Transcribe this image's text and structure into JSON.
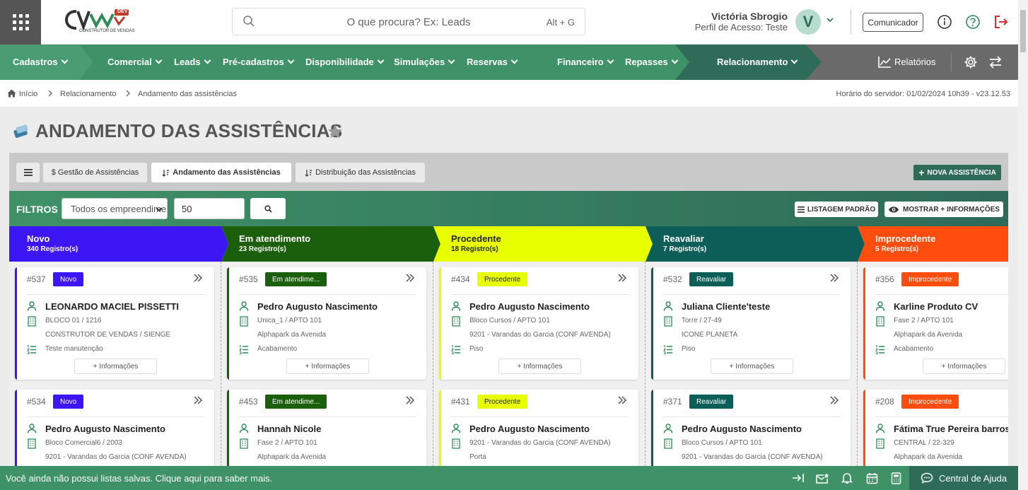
{
  "topbar": {
    "logo_text": "CV",
    "logo_badge": "DEV",
    "logo_sub": "CONSTRUTOR DE VENDAS",
    "search_placeholder": "O que procura? Ex: Leads",
    "search_shortcut": "Alt + G",
    "user_name": "Victória Sbrogio",
    "user_profile": "Perfil de Acesso: Teste",
    "avatar_letter": "V",
    "communicator_label": "Comunicador"
  },
  "nav": {
    "items": [
      "Cadastros",
      "Comercial",
      "Leads",
      "Pré-cadastros",
      "Disponibilidade",
      "Simulações",
      "Reservas",
      "Financeiro",
      "Repasses",
      "Relacionamento"
    ],
    "reports_label": "Relatórios"
  },
  "breadcrumb": {
    "items": [
      "Início",
      "Relacionamento",
      "Andamento das assistências"
    ],
    "server_time": "Horário do servidor: 01/02/2024 10h39 - v23.12.53"
  },
  "page": {
    "title": "ANDAMENTO DAS ASSISTÊNCIAS"
  },
  "tabs": {
    "items": [
      "$ Gestão de Assistências",
      "Andamento das Assistências",
      "Distribuição das Assistências"
    ],
    "new_button": "NOVA ASSISTÊNCIA"
  },
  "filters": {
    "label": "FILTROS",
    "select_value": "Todos os empreendimentos",
    "limit_value": "50",
    "default_list_button": "LISTAGEM PADRÃO",
    "show_more_button": "MOSTRAR + INFORMAÇÕES"
  },
  "colors": {
    "green": "#3f9167",
    "dark_green": "#2e6b59",
    "novo": "#3d16f5",
    "em_atendimento": "#1b5e0c",
    "procedente": "#e8ff00",
    "reavaliar": "#0d5e58",
    "improcedente": "#ff4d0d"
  },
  "more_info_label": "+ Informações",
  "columns": [
    {
      "name": "Novo",
      "count": "340 Registro(s)",
      "cards": [
        {
          "id": "#537",
          "badge": "Novo",
          "name": "LEONARDO MACIEL PISSETTI",
          "unit": "BLOCO 01 / 1216",
          "project": "CONSTRUTOR DE VENDAS / SIENGE",
          "item": "Teste manutenção"
        },
        {
          "id": "#534",
          "badge": "Novo",
          "name": "Pedro Augusto Nascimento",
          "unit": "Bloco Comercial6 / 2003",
          "project": "9201 - Varandas do Garcia (CONF AVENDA)",
          "item": ""
        }
      ]
    },
    {
      "name": "Em atendimento",
      "count": "23 Registro(s)",
      "cards": [
        {
          "id": "#535",
          "badge": "Em atendime...",
          "name": "Pedro Augusto Nascimento",
          "unit": "Unica_1 / APTO 101",
          "project": "Alphapark da Avenida",
          "item": "Acabamento"
        },
        {
          "id": "#453",
          "badge": "Em atendime...",
          "name": "Hannah Nicole",
          "unit": "Fase 2 / APTO 101",
          "project": "Alphapark da Avenida",
          "item": ""
        }
      ]
    },
    {
      "name": "Procedente",
      "count": "18 Registro(s)",
      "cards": [
        {
          "id": "#434",
          "badge": "Procedente",
          "name": "Pedro Augusto Nascimento",
          "unit": "Bloco Cursos / APTO 101",
          "project": "9201 - Varandas do Garcia (CONF AVENDA)",
          "item": "Piso"
        },
        {
          "id": "#431",
          "badge": "Procedente",
          "name": "Pedro Augusto Nascimento",
          "unit": "9201 - Varandas do Garcia (CONF AVENDA)",
          "project": "Porta",
          "item": ""
        }
      ]
    },
    {
      "name": "Reavaliar",
      "count": "7 Registro(s)",
      "cards": [
        {
          "id": "#532",
          "badge": "Reavaliar",
          "name": "Juliana Cliente'teste",
          "unit": "Torre / 27-49",
          "project": "ÍCONE PLANETA",
          "item": "Piso"
        },
        {
          "id": "#371",
          "badge": "Reavaliar",
          "name": "Pedro Augusto Nascimento",
          "unit": "Bloco Cursos / APTO 101",
          "project": "9201 - Varandas do Garcia (CONF AVENDA)",
          "item": ""
        }
      ]
    },
    {
      "name": "Improcedente",
      "count": "5 Registro(s)",
      "cards": [
        {
          "id": "#356",
          "badge": "Improcedente",
          "name": "Karline Produto CV",
          "unit": "Fase 2 / APTO 101",
          "project": "Alphapark da Avenida",
          "item": "Acabamento"
        },
        {
          "id": "#208",
          "badge": "Improcedente",
          "name": "Fátima True Pereira barros",
          "unit": "CENTRAL / 22-329",
          "project": "Alphapark da Avenida",
          "item": ""
        }
      ]
    }
  ],
  "footer": {
    "message": "Você ainda não possui listas salvas. Clique aqui para saber mais.",
    "help_label": "Central de Ajuda"
  }
}
